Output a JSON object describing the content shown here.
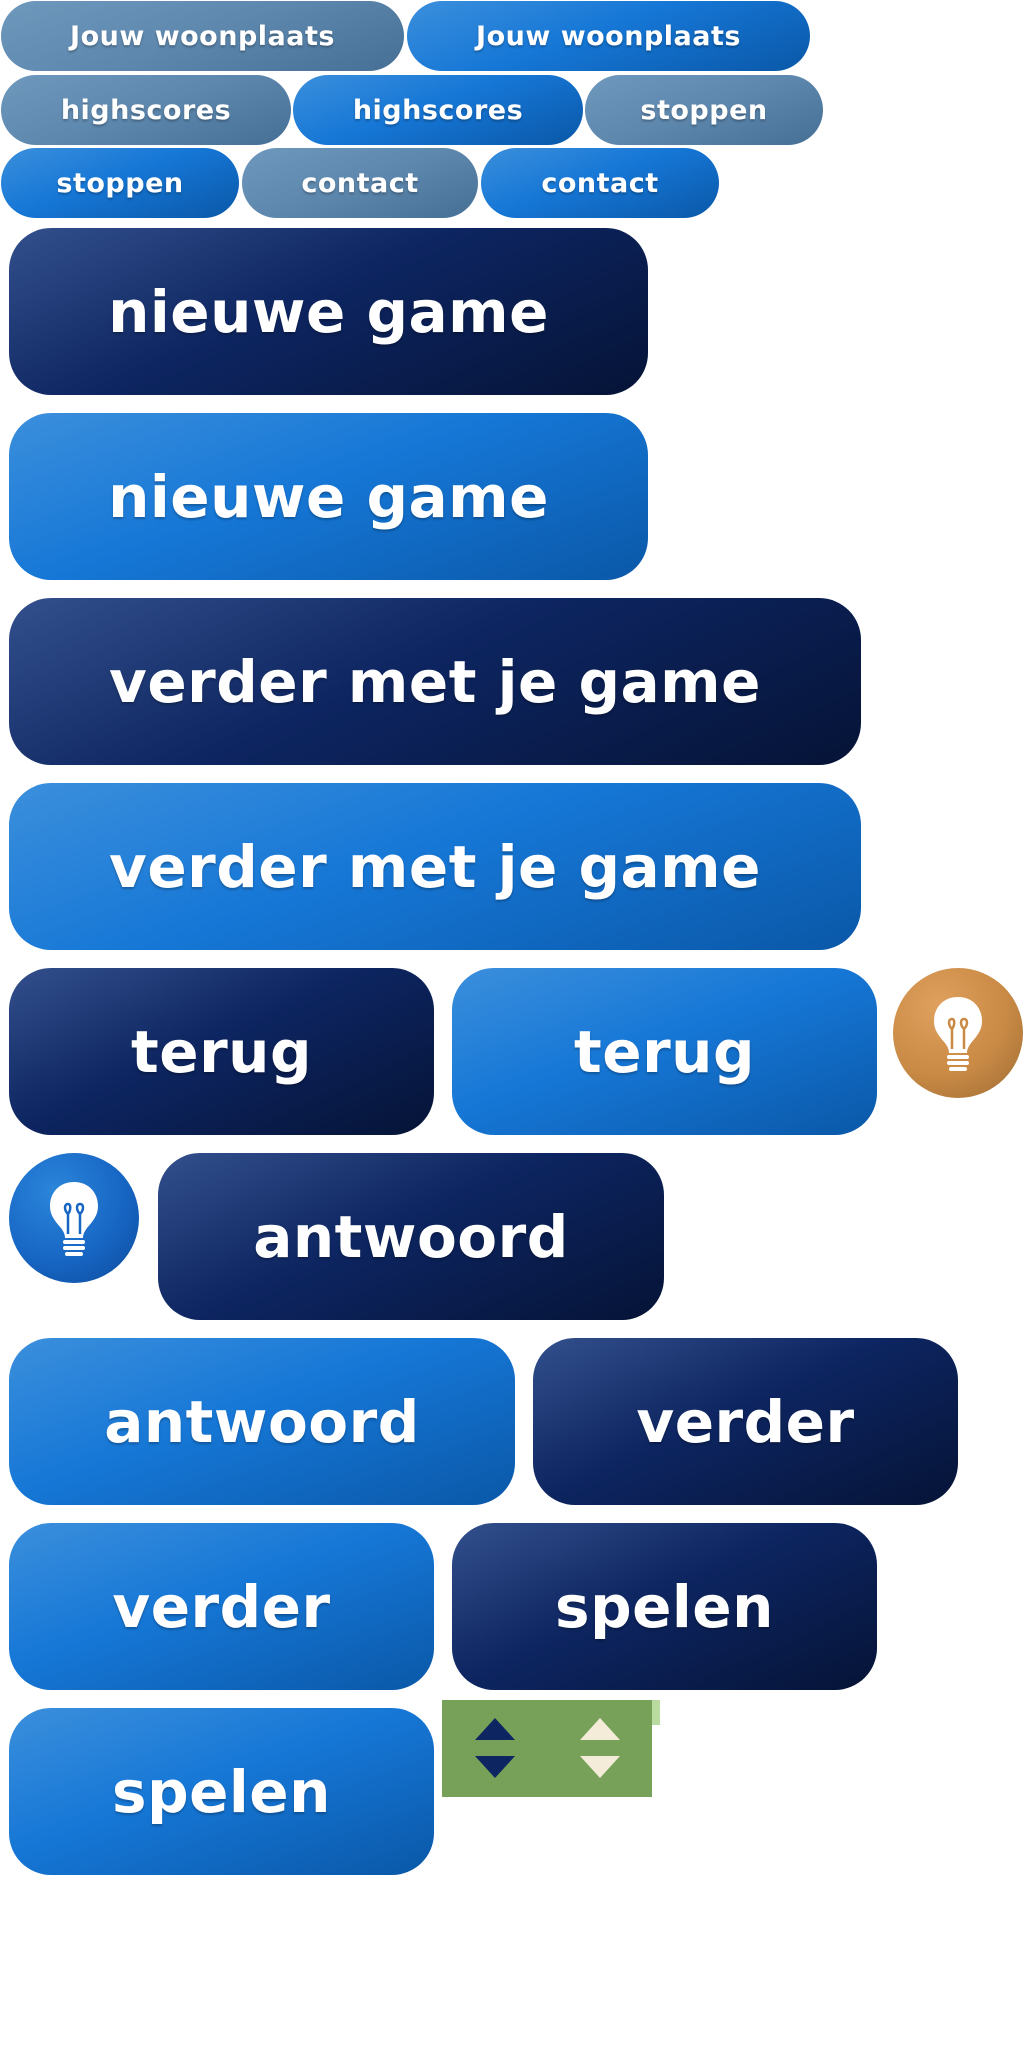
{
  "buttons": {
    "woonplaats_grey": "Jouw woonplaats",
    "woonplaats_bright": "Jouw woonplaats",
    "highscores_grey": "highscores",
    "highscores_bright": "highscores",
    "stoppen_grey": "stoppen",
    "stoppen_bright": "stoppen",
    "contact_grey": "contact",
    "contact_bright": "contact",
    "nieuwe_game_dark": "nieuwe game",
    "nieuwe_game_bright": "nieuwe game",
    "verder_met_game_dark": "verder met je game",
    "verder_met_game_bright": "verder met je game",
    "terug_dark": "terug",
    "terug_bright": "terug",
    "antwoord_dark": "antwoord",
    "antwoord_bright": "antwoord",
    "verder_dark": "verder",
    "verder_bright": "verder",
    "spelen_dark": "spelen",
    "spelen_bright": "spelen"
  },
  "icons": {
    "hint_orange": "lightbulb-icon",
    "hint_blue": "lightbulb-icon",
    "spinner_dark": "up-down-arrows-icon",
    "spinner_light": "up-down-arrows-icon"
  },
  "colors": {
    "grey_button": "#5d87ad",
    "bright_button": "#1677d6",
    "dark_button": "#0d2561",
    "orange_hint": "#c98a45",
    "spinner_background": "#77a158",
    "arrow_dark": "#0d2561",
    "arrow_light": "#f4ecd8"
  }
}
